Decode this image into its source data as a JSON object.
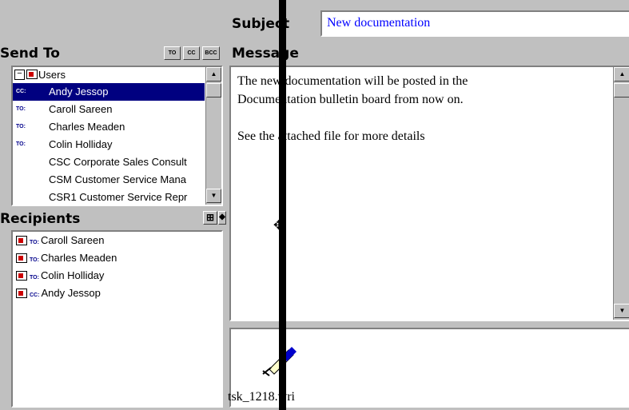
{
  "subject": {
    "label": "Subject",
    "value": "New documentation"
  },
  "send_to": {
    "title": "Send To",
    "buttons": [
      "TO",
      "CC",
      "BCC"
    ],
    "group": "Users",
    "items": [
      {
        "tag": "CC:",
        "name": "Andy Jessop",
        "selected": true
      },
      {
        "tag": "TO:",
        "name": "Caroll Sareen"
      },
      {
        "tag": "TO:",
        "name": "Charles Meaden"
      },
      {
        "tag": "TO:",
        "name": "Colin Holliday"
      },
      {
        "tag": "",
        "name": "CSC Corporate Sales Consult"
      },
      {
        "tag": "",
        "name": "CSM Customer Service Mana"
      },
      {
        "tag": "",
        "name": "CSR1 Customer Service Repr"
      }
    ]
  },
  "recipients": {
    "title": "Recipients",
    "items": [
      {
        "tag": "TO:",
        "name": "Caroll Sareen"
      },
      {
        "tag": "TO:",
        "name": "Charles Meaden"
      },
      {
        "tag": "TO:",
        "name": "Colin Holliday"
      },
      {
        "tag": "CC:",
        "name": "Andy Jessop"
      }
    ]
  },
  "message": {
    "title": "Message",
    "lines": [
      "The new documentation will be posted in the",
      "Documentation bulletin board from now on.",
      "",
      "See the attached file for more details"
    ]
  },
  "attachment": {
    "filename": "tsk_1218.wri"
  },
  "colors": {
    "selection": "#000080",
    "window": "#c0c0c0",
    "subject_text": "#0000ff"
  }
}
